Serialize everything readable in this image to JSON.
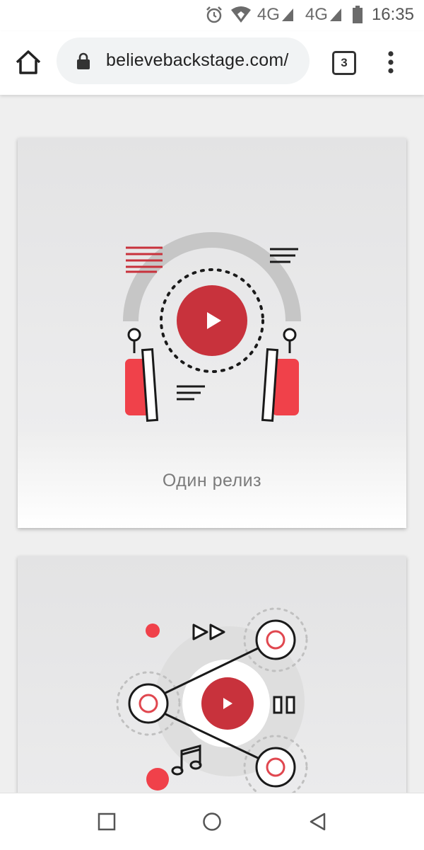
{
  "status_bar": {
    "network_1": "4G",
    "network_2": "4G",
    "time": "16:35",
    "icons": [
      "alarm-icon",
      "wifi-icon",
      "signal-icon",
      "signal-icon",
      "battery-icon"
    ]
  },
  "toolbar": {
    "url": "believebackstage.com/",
    "tab_count": "3",
    "icons": [
      "home-icon",
      "lock-icon",
      "more-vert-icon"
    ]
  },
  "cards": [
    {
      "caption": "Один релиз",
      "illustration": "headphones-play-illustration"
    },
    {
      "caption": "",
      "illustration": "network-play-illustration"
    }
  ],
  "colors": {
    "accent_red": "#c8323c",
    "pad_red": "#f0414a",
    "arc_gray": "#c6c6c6",
    "dark_line": "#1a1a1a"
  },
  "nav_bar": {
    "icons": [
      "recents-square-icon",
      "home-circle-icon",
      "back-triangle-icon"
    ]
  }
}
